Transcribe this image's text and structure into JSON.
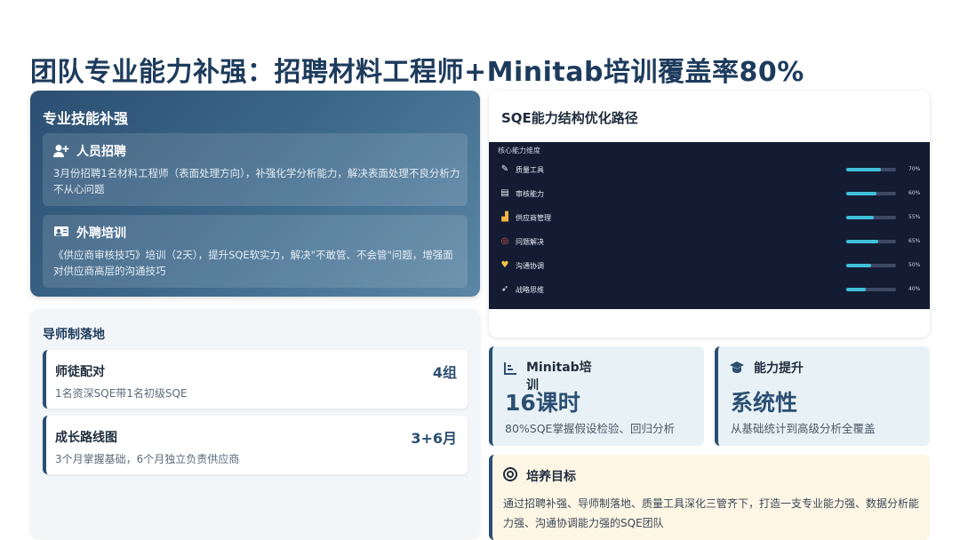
{
  "title": "团队专业能力补强：招聘材料工程师+Minitab培训覆盖率80%",
  "skills": {
    "heading": "专业技能补强",
    "items": [
      {
        "icon": "user-plus-icon",
        "title": "人员招聘",
        "desc": "3月份招聘1名材料工程师（表面处理方向），补强化学分析能力，解决表面处理不良分析力不从心问题"
      },
      {
        "icon": "training-board-icon",
        "title": "外聘培训",
        "desc": "《供应商审核技巧》培训（2天），提升SQE软实力，解决\"不敢管、不会管\"问题，增强面对供应商高层的沟通技巧"
      }
    ]
  },
  "mentor": {
    "heading": "导师制落地",
    "rows": [
      {
        "label": "师徒配对",
        "desc": "1名资深SQE带1名初级SQE",
        "value": "4组"
      },
      {
        "label": "成长路线图",
        "desc": "3个月掌握基础，6个月独立负责供应商",
        "value": "3+6月"
      }
    ]
  },
  "structure": {
    "heading": "SQE能力结构优化路径",
    "caption": "核心能力维度",
    "bars": [
      {
        "icon": "pen-icon",
        "glyph": "✎",
        "label": "质量工具",
        "value": 0.7,
        "pct": "70%"
      },
      {
        "icon": "clipboard-icon",
        "glyph": "▤",
        "label": "审核能力",
        "value": 0.6,
        "pct": "60%"
      },
      {
        "icon": "factory-icon",
        "glyph": "▟",
        "label": "供应商管理",
        "value": 0.55,
        "pct": "55%"
      },
      {
        "icon": "target-icon",
        "glyph": "◎",
        "label": "问题解决",
        "value": 0.65,
        "pct": "65%"
      },
      {
        "icon": "heart-icon",
        "glyph": "♥",
        "label": "沟通协调",
        "value": 0.5,
        "pct": "50%"
      },
      {
        "icon": "rocket-icon",
        "glyph": "➶",
        "label": "战略思维",
        "value": 0.4,
        "pct": "40%"
      }
    ]
  },
  "stats": [
    {
      "icon": "chart-icon",
      "title": "Minitab培训",
      "big": "16课时",
      "desc": "80%SQE掌握假设检验、回归分析"
    },
    {
      "icon": "graduation-cap-icon",
      "title": "能力提升",
      "big": "系统性",
      "desc": "从基础统计到高级分析全覆盖"
    }
  ],
  "goal": {
    "heading": "培养目标",
    "desc": "通过招聘补强、导师制落地、质量工具深化三管齐下，打造一支专业能力强、数据分析能力强、沟通协调能力强的SQE团队"
  },
  "colors": {
    "primary": "#2b4f72",
    "bar": "#3fc1da",
    "dark_panel": "#141c33",
    "goal_bg": "#fdf6e5"
  }
}
